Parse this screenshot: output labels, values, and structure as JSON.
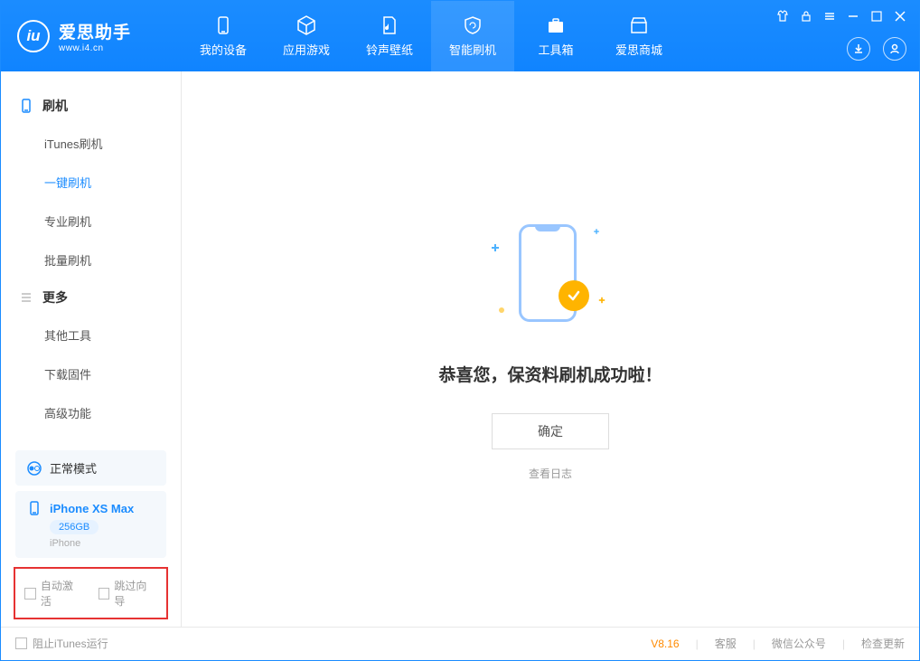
{
  "header": {
    "brand": "爱思助手",
    "url": "www.i4.cn",
    "tabs": [
      {
        "label": "我的设备"
      },
      {
        "label": "应用游戏"
      },
      {
        "label": "铃声壁纸"
      },
      {
        "label": "智能刷机"
      },
      {
        "label": "工具箱"
      },
      {
        "label": "爱思商城"
      }
    ]
  },
  "sidebar": {
    "section1": "刷机",
    "items1": [
      {
        "label": "iTunes刷机"
      },
      {
        "label": "一键刷机"
      },
      {
        "label": "专业刷机"
      },
      {
        "label": "批量刷机"
      }
    ],
    "section2": "更多",
    "items2": [
      {
        "label": "其他工具"
      },
      {
        "label": "下载固件"
      },
      {
        "label": "高级功能"
      }
    ],
    "mode_label": "正常模式",
    "device_name": "iPhone XS Max",
    "device_storage": "256GB",
    "device_type": "iPhone",
    "chk_auto_activate": "自动激活",
    "chk_skip_guide": "跳过向导"
  },
  "main": {
    "success_msg": "恭喜您，保资料刷机成功啦！",
    "ok_label": "确定",
    "log_link": "查看日志"
  },
  "footer": {
    "block_itunes": "阻止iTunes运行",
    "version": "V8.16",
    "links": [
      "客服",
      "微信公众号",
      "检查更新"
    ]
  }
}
